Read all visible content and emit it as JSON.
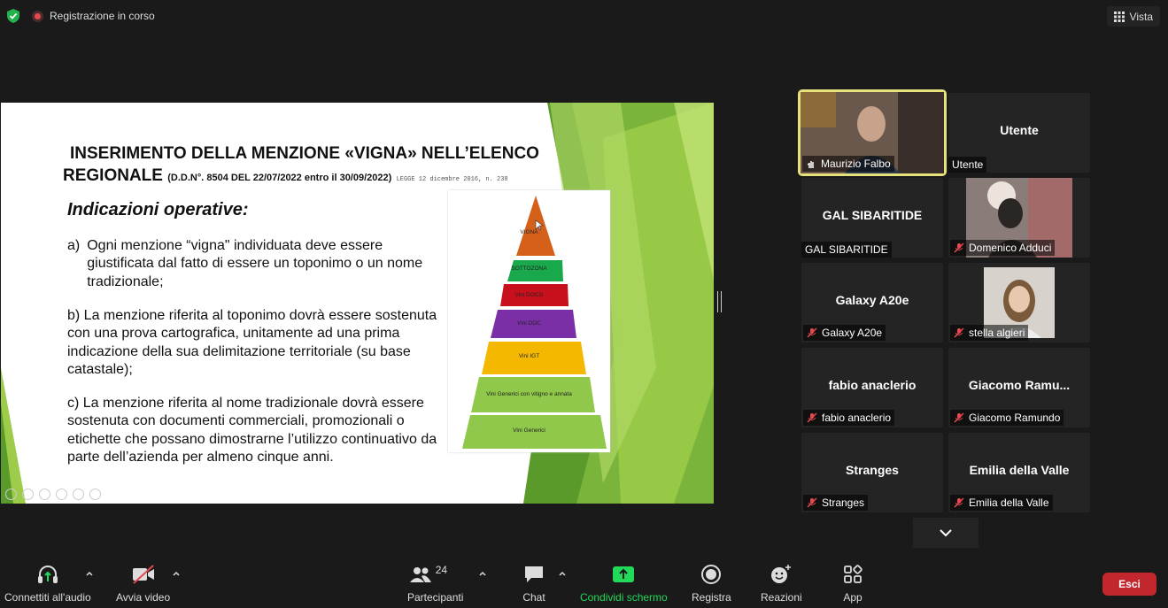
{
  "top_bar": {
    "recording_label": "Registrazione in corso",
    "view_label": "Vista"
  },
  "slide": {
    "title_line1": "INSERIMENTO DELLA MENZIONE «VIGNA» NELL’ELENCO",
    "title_line2": "REGIONALE",
    "title_ref": "(D.D.N°. 8504 DEL 22/07/2022 entro il 30/09/2022)",
    "title_law": "LEGGE 12 dicembre 2016, n. 238",
    "heading": "Indicazioni operative:",
    "para_a_marker": "a)",
    "para_a": "Ogni menzione “vigna\" individuata deve essere giustificata dal fatto di essere un toponimo o un nome tradizionale;",
    "para_b": "b) La menzione riferita al toponimo dovrà essere sostenuta con una prova cartografica, unitamente ad una prima indicazione della sua delimitazione territoriale (su base catastale);",
    "para_c": "c) La menzione riferita al nome tradizionale dovrà essere sostenuta con documenti commerciali, promozionali o etichette che possano dimostrarne l’utilizzo continuativo da parte dell’azienda per almeno cinque anni.",
    "pyramid": [
      {
        "label": "VIGNA",
        "color": "#d4601a"
      },
      {
        "label": "SOTTOZONA",
        "color": "#1aa84c"
      },
      {
        "label": "Vini DOCG",
        "color": "#c8101c"
      },
      {
        "label": "Vini DOC",
        "color": "#7a2fa6"
      },
      {
        "label": "Vini IGT",
        "color": "#f5b800"
      },
      {
        "label": "Vini Generici con vitigno e annata",
        "color": "#8fc84a"
      },
      {
        "label": "Vini Generici",
        "color": "#8fc84a"
      }
    ]
  },
  "participants": [
    {
      "tile_name": "",
      "name": "Maurizio Falbo",
      "muted": false,
      "video": true,
      "active": true
    },
    {
      "tile_name": "Utente",
      "name": "Utente",
      "muted": false,
      "video": false,
      "active": false
    },
    {
      "tile_name": "GAL SIBARITIDE",
      "name": "GAL SIBARITIDE",
      "muted": false,
      "video": false,
      "active": false
    },
    {
      "tile_name": "",
      "name": "Domenico Adduci",
      "muted": true,
      "video": true,
      "active": false
    },
    {
      "tile_name": "Galaxy A20e",
      "name": "Galaxy A20e",
      "muted": true,
      "video": false,
      "active": false
    },
    {
      "tile_name": "",
      "name": "stella algieri",
      "muted": true,
      "video": true,
      "active": false
    },
    {
      "tile_name": "fabio anaclerio",
      "name": "fabio anaclerio",
      "muted": true,
      "video": false,
      "active": false
    },
    {
      "tile_name": "Giacomo  Ramu...",
      "name": "Giacomo Ramundo",
      "muted": true,
      "video": false,
      "active": false
    },
    {
      "tile_name": "Stranges",
      "name": "Stranges",
      "muted": true,
      "video": false,
      "active": false
    },
    {
      "tile_name": "Emilia della Valle",
      "name": "Emilia della Valle",
      "muted": true,
      "video": false,
      "active": false
    }
  ],
  "toolbar": {
    "audio_label": "Connettiti all'audio",
    "video_label": "Avvia video",
    "participants_label": "Partecipanti",
    "participants_count": "24",
    "chat_label": "Chat",
    "share_label": "Condividi schermo",
    "record_label": "Registra",
    "reactions_label": "Reazioni",
    "apps_label": "App",
    "leave_label": "Esci",
    "share_color": "#23d959",
    "leave_color": "#c1272d"
  }
}
